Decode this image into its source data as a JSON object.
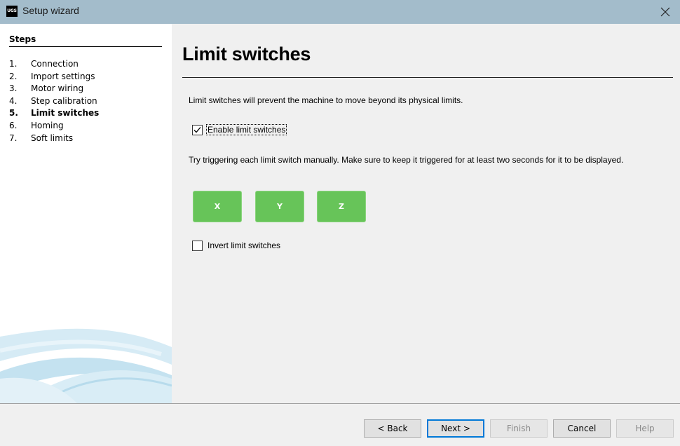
{
  "window": {
    "app_icon_text": "UGS",
    "title": "Setup wizard",
    "close_icon": "close-icon"
  },
  "sidebar": {
    "heading": "Steps",
    "steps": [
      {
        "num": "1.",
        "label": "Connection",
        "active": false
      },
      {
        "num": "2.",
        "label": "Import settings",
        "active": false
      },
      {
        "num": "3.",
        "label": "Motor wiring",
        "active": false
      },
      {
        "num": "4.",
        "label": "Step calibration",
        "active": false
      },
      {
        "num": "5.",
        "label": "Limit switches",
        "active": true
      },
      {
        "num": "6.",
        "label": "Homing",
        "active": false
      },
      {
        "num": "7.",
        "label": "Soft limits",
        "active": false
      }
    ]
  },
  "main": {
    "title": "Limit switches",
    "description": "Limit switches will prevent the machine to move beyond its physical limits.",
    "enable_checkbox": {
      "label": "Enable limit switches",
      "checked": true
    },
    "instructions": "Try triggering each limit switch manually. Make sure to keep it triggered for at least two seconds for it to be displayed.",
    "axis_indicators": [
      {
        "label": "X",
        "color": "#67c459"
      },
      {
        "label": "Y",
        "color": "#67c459"
      },
      {
        "label": "Z",
        "color": "#67c459"
      }
    ],
    "invert_checkbox": {
      "label": "Invert limit switches",
      "checked": false
    }
  },
  "footer": {
    "back_label": "< Back",
    "next_label": "Next >",
    "finish_label": "Finish",
    "cancel_label": "Cancel",
    "help_label": "Help"
  },
  "colors": {
    "titlebar": "#a3bccb",
    "indicator_green": "#67c459",
    "default_button_border": "#0078d7"
  }
}
